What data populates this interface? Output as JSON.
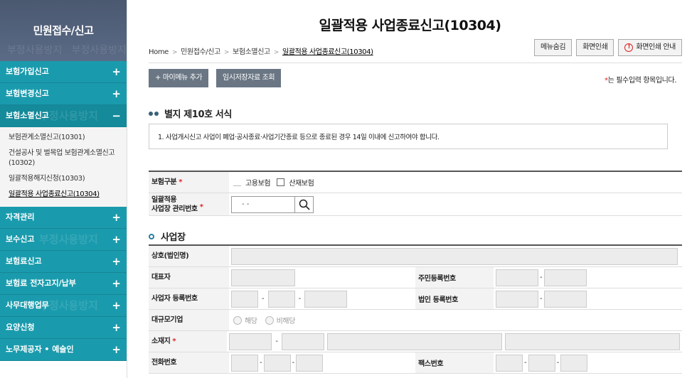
{
  "sidebar": {
    "title": "민원접수/신고",
    "watermark": "부정사용방지",
    "menus": [
      {
        "label": "보험가입신고",
        "icon": "+"
      },
      {
        "label": "보험변경신고",
        "icon": "+"
      },
      {
        "label": "보험소멸신고",
        "icon": "−"
      },
      {
        "label": "자격관리",
        "icon": "+"
      },
      {
        "label": "보수신고",
        "icon": "+"
      },
      {
        "label": "보험료신고",
        "icon": "+"
      },
      {
        "label": "보험료 전자고지/납부",
        "icon": "+"
      },
      {
        "label": "사무대행업무",
        "icon": "+"
      },
      {
        "label": "요양신청",
        "icon": "+"
      },
      {
        "label": "노무제공자 • 예술인",
        "icon": "+"
      }
    ],
    "submenu": [
      "보험관계소멸신고(10301)",
      "건설공사 및 벌목업 보험관계소멸신고(10302)",
      "일괄적용해지신청(10303)",
      "일괄적용 사업종료신고(10304)"
    ]
  },
  "header": {
    "title": "일괄적용 사업종료신고(10304)",
    "breadcrumb": [
      "Home",
      "민원접수/신고",
      "보험소멸신고",
      "일괄적용 사업종료신고(10304)"
    ],
    "buttons": {
      "hide_menu": "메뉴숨김",
      "print": "화면인쇄",
      "print_guide": "화면인쇄 안내"
    }
  },
  "actions": {
    "add_my_menu": "+ 마이메뉴 추가",
    "temp_saved": "임시저장자료 조회"
  },
  "required_note": {
    "star": "*",
    "text": "는 필수입력 항목입니다."
  },
  "form_section": {
    "title": "별지 제10호 서식",
    "notice": "1. 사업개시신고 사업이 폐업·공사종료·사업기간종료 등으로 종료된 경우 14일 이내에 신고하여야 합니다."
  },
  "insurance": {
    "type_label": "보험구분",
    "employment": "고용보험",
    "industrial": "산재보험",
    "mgmt_label": "일괄적용\n사업장 관리번호",
    "mgmt_value": "-  -",
    "star": "*"
  },
  "workplace": {
    "title": "사업장",
    "trade_name": "상호(법인명)",
    "representative": "대표자",
    "resident_no": "주민등록번호",
    "biz_reg_no": "사업자 등록번호",
    "corp_reg_no": "법인 등록번호",
    "large_company": "대규모기업",
    "yes": "해당",
    "no": "비해당",
    "address": "소재지",
    "phone": "전화번호",
    "fax": "팩스번호",
    "star": "*"
  }
}
